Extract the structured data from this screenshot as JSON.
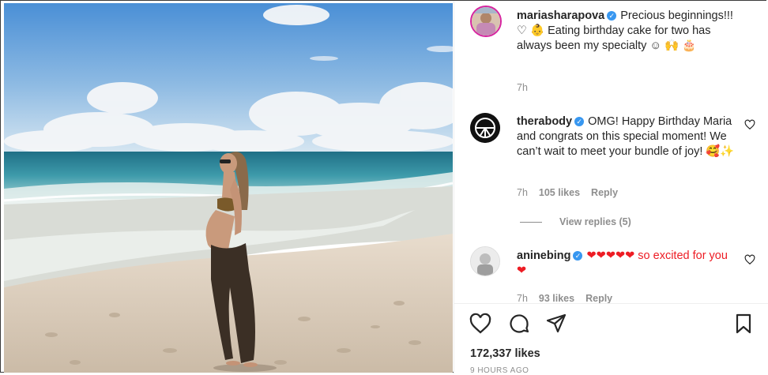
{
  "post": {
    "image_alt": "Pregnant woman on beach",
    "caption": {
      "username": "mariasharapova",
      "text": "Precious beginnings!!! ♡ 👶 Eating birthday cake for two has always been my specialty ☺ 🙌 🎂",
      "time": "7h"
    },
    "comments": [
      {
        "username": "therabody",
        "text": "OMG! Happy Birthday Maria and congrats on this special moment! We can’t wait to meet your bundle of joy! 🥰✨",
        "time": "7h",
        "likes": "105 likes",
        "reply": "Reply",
        "view_replies": "View replies (5)"
      },
      {
        "username": "aninebing",
        "text": "❤❤❤❤❤ so excited for you❤",
        "time": "7h",
        "likes": "93 likes",
        "reply": "Reply"
      }
    ],
    "likes_count": "172,337 likes",
    "posted": "9 HOURS AGO"
  },
  "colors": {
    "verified": "#3897f0",
    "heart": "#ed1c24",
    "muted": "#8e8e8e",
    "text": "#262626"
  },
  "icons": [
    "like-icon",
    "comment-icon",
    "share-icon",
    "save-icon",
    "verified-icon"
  ]
}
